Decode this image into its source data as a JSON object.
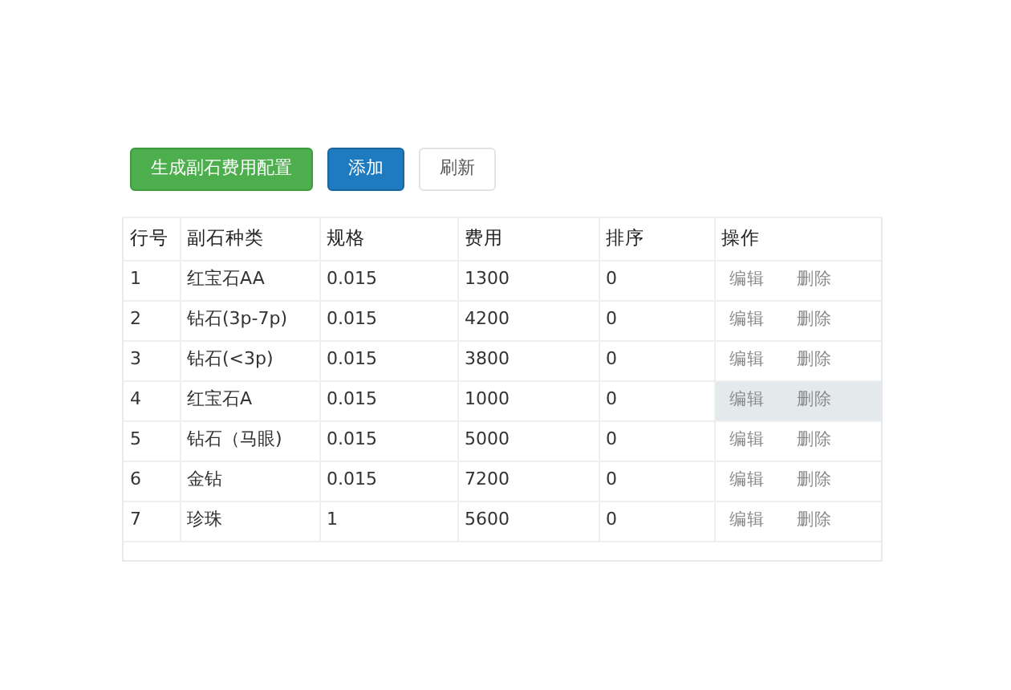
{
  "toolbar": {
    "buttons": [
      {
        "label": "生成副石费用配置",
        "kind": "success"
      },
      {
        "label": "添加",
        "kind": "primary"
      },
      {
        "label": "刷新",
        "kind": "default"
      }
    ]
  },
  "table": {
    "columns": [
      "行号",
      "副石种类",
      "规格",
      "费用",
      "排序",
      "操作"
    ],
    "rows": [
      {
        "cells": [
          "1",
          "红宝石AA",
          "0.015",
          "1300",
          "0"
        ],
        "actions": [
          "编辑",
          "删除"
        ],
        "hovered": false
      },
      {
        "cells": [
          "2",
          "钻石(3p-7p)",
          "0.015",
          "4200",
          "0"
        ],
        "actions": [
          "编辑",
          "删除"
        ],
        "hovered": false
      },
      {
        "cells": [
          "3",
          "钻石(<3p)",
          "0.015",
          "3800",
          "0"
        ],
        "actions": [
          "编辑",
          "删除"
        ],
        "hovered": false
      },
      {
        "cells": [
          "4",
          "红宝石A",
          "0.015",
          "1000",
          "0"
        ],
        "actions": [
          "编辑",
          "删除"
        ],
        "hovered": true
      },
      {
        "cells": [
          "5",
          "钻石（马眼)",
          "0.015",
          "5000",
          "0"
        ],
        "actions": [
          "编辑",
          "删除"
        ],
        "hovered": false
      },
      {
        "cells": [
          "6",
          "金钻",
          "0.015",
          "7200",
          "0"
        ],
        "actions": [
          "编辑",
          "删除"
        ],
        "hovered": false
      },
      {
        "cells": [
          "7",
          "珍珠",
          "1",
          "5600",
          "0"
        ],
        "actions": [
          "编辑",
          "删除"
        ],
        "hovered": false
      }
    ]
  }
}
